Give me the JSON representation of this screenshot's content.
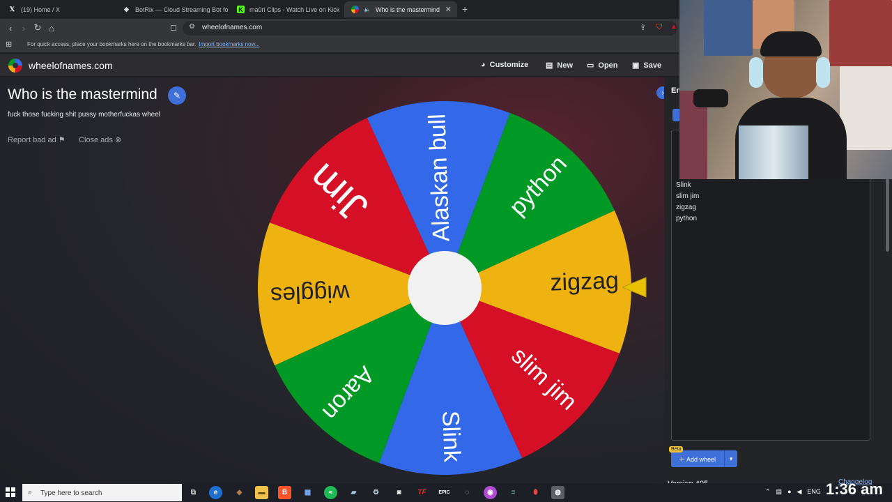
{
  "browser": {
    "tabs": [
      {
        "title": "(19) Home / X",
        "favicon": "x-logo-icon"
      },
      {
        "title": "BotRix — Cloud Streaming Bot for Tw",
        "favicon": "botrix-icon"
      },
      {
        "title": "ma0ri Clips - Watch Live on Kick",
        "favicon": "kick-icon"
      },
      {
        "title": "Who is the mastermind",
        "favicon": "wheel-icon",
        "active": true
      }
    ],
    "new_tab": "+",
    "url": "wheelofnames.com",
    "bookmarks_bar": {
      "text": "For quick access, place your bookmarks here on the bookmarks bar.",
      "link": "Import bookmarks now..."
    }
  },
  "site": {
    "name": "wheelofnames.com",
    "nav": [
      {
        "label": "Customize",
        "icon": "palette-icon"
      },
      {
        "label": "New",
        "icon": "new-file-icon"
      },
      {
        "label": "Open",
        "icon": "folder-open-icon"
      },
      {
        "label": "Save",
        "icon": "save-icon"
      }
    ]
  },
  "wheel": {
    "title": "Who is the mastermind",
    "description": "fuck those fucking shit pussy motherfuckas wheel",
    "report_ad": "Report bad ad",
    "close_ads": "Close ads",
    "segments": [
      {
        "label": "zigzag",
        "color": "#eeb211"
      },
      {
        "label": "slim jim",
        "color": "#d50f25"
      },
      {
        "label": "Slink",
        "color": "#3369e8"
      },
      {
        "label": "Aaron",
        "color": "#009925"
      },
      {
        "label": "wiggles",
        "color": "#eeb211"
      },
      {
        "label": "Jim",
        "color": "#d50f25"
      },
      {
        "label": "Alaskan bull",
        "color": "#3369e8"
      },
      {
        "label": "python",
        "color": "#009925"
      }
    ],
    "pointer_color": "#e8c200"
  },
  "panel": {
    "tab_label": "En",
    "entries": [
      "Slink",
      "slim jim",
      "zigzag",
      "python"
    ],
    "add_wheel": "Add wheel",
    "beta_badge": "Beta",
    "version": "Version 405",
    "changelog": "Changelog"
  },
  "taskbar": {
    "search_placeholder": "Type here to search",
    "tray_lang": "ENG",
    "clock": "1:36 am"
  }
}
